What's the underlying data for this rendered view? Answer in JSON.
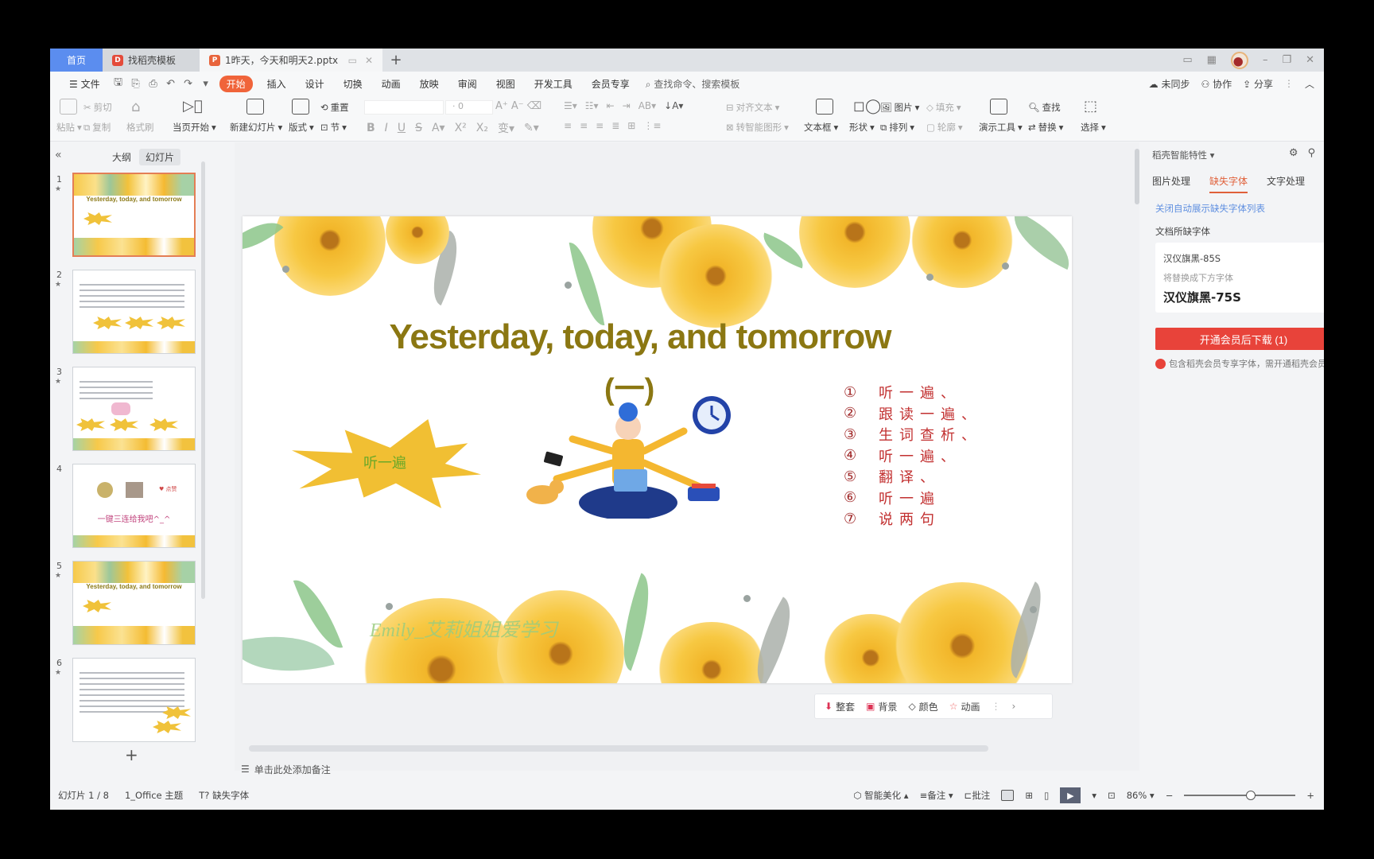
{
  "tabs": {
    "home": "首页",
    "template": "找稻壳模板",
    "document": "1昨天，今天和明天2.pptx",
    "add": "+"
  },
  "window": {
    "minimize": "–",
    "restore": "❐",
    "close": "✕"
  },
  "menu": {
    "file": "文件",
    "items": [
      "开始",
      "插入",
      "设计",
      "切换",
      "动画",
      "放映",
      "审阅",
      "视图",
      "开发工具",
      "会员专享"
    ],
    "active": "开始",
    "search_placeholder": "查找命令、搜索模板",
    "right": [
      "未同步",
      "协作",
      "分享"
    ]
  },
  "ribbon": {
    "paste": "粘贴",
    "cut": "剪切",
    "copy": "复制",
    "format_painter": "格式刷",
    "play_from_current": "当页开始",
    "new_slide": "新建幻灯片",
    "layout": "版式",
    "reset": "重置",
    "section": "节",
    "font_size": "0",
    "align_text": "对齐文本",
    "smart_art": "转智能图形",
    "textbox": "文本框",
    "shape": "形状",
    "picture": "图片",
    "fill": "填充",
    "arrange": "排列",
    "outline": "轮廓",
    "presentation_tools": "演示工具",
    "find": "查找",
    "replace": "替换",
    "select": "选择"
  },
  "left_panel": {
    "tabs": [
      "大纲",
      "幻灯片"
    ],
    "active_tab": "幻灯片",
    "slides": [
      {
        "num": "1",
        "title": "Yesterday, today, and tomorrow",
        "selected": true
      },
      {
        "num": "2",
        "selected": false
      },
      {
        "num": "3",
        "selected": false
      },
      {
        "num": "4",
        "caption": "一键三连给我吧^_^",
        "selected": false
      },
      {
        "num": "5",
        "title": "Yesterday, today, and tomorrow",
        "selected": false
      },
      {
        "num": "6",
        "selected": false
      }
    ]
  },
  "slide": {
    "title": "Yesterday, today, and tomorrow",
    "subtitle": "(一)",
    "burst_text": "听一遍",
    "steps": [
      {
        "n": "①",
        "t": "听一遍、"
      },
      {
        "n": "②",
        "t": "跟读一遍、"
      },
      {
        "n": "③",
        "t": "生词查析、"
      },
      {
        "n": "④",
        "t": "听一遍、"
      },
      {
        "n": "⑤",
        "t": "翻译、"
      },
      {
        "n": "⑥",
        "t": "听一遍"
      },
      {
        "n": "⑦",
        "t": "说两句"
      }
    ],
    "watermark": "Emily_艾莉姐姐爱学习"
  },
  "slide_toolbar": [
    "整套",
    "背景",
    "颜色",
    "动画"
  ],
  "notes_placeholder": "单击此处添加备注",
  "right_panel": {
    "title": "稻壳智能特性",
    "tabs": [
      "图片处理",
      "缺失字体",
      "文字处理"
    ],
    "active_tab": "缺失字体",
    "link": "关闭自动展示缺失字体列表",
    "section_label": "文档所缺字体",
    "missing_font": "汉仪旗黑-85S",
    "replace_hint": "将替换成下方字体",
    "replacement_font": "汉仪旗黑-75S",
    "download_button": "开通会员后下载 (1)",
    "note": "包含稻壳会员专享字体，需开通稻壳会员"
  },
  "status": {
    "slide_count": "幻灯片 1 / 8",
    "theme": "1_Office 主题",
    "missing_font": "缺失字体",
    "smart_beautify": "智能美化",
    "notes": "备注",
    "comments": "批注",
    "zoom": "86%",
    "zoom_fraction": 0.6
  }
}
